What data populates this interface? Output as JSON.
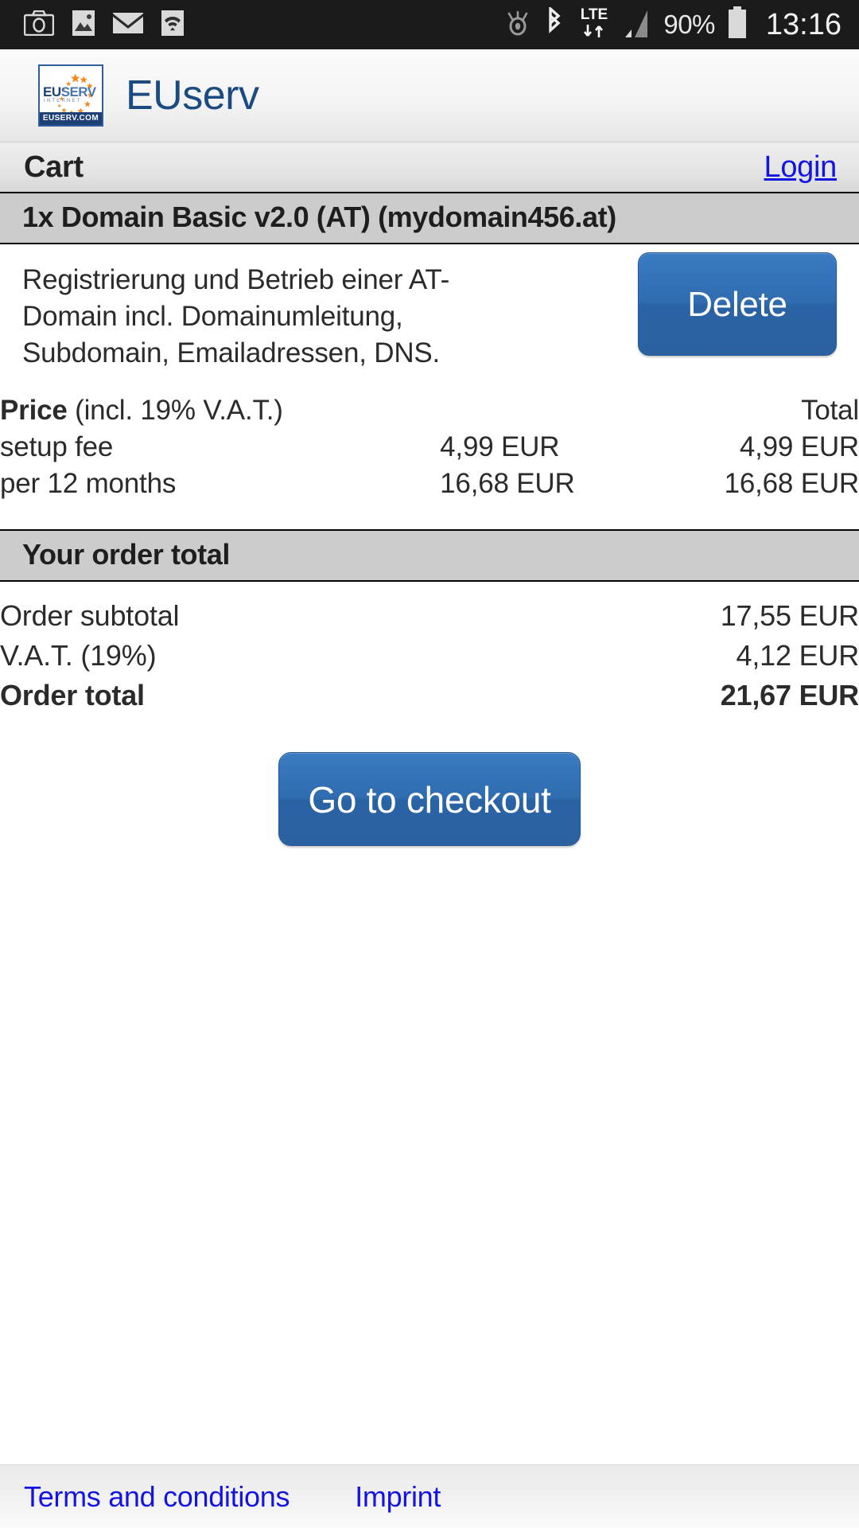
{
  "statusbar": {
    "left_icons": [
      "camera-icon",
      "image-icon",
      "email-icon",
      "wifi-icon"
    ],
    "right_icons": [
      "eye-icon",
      "bluetooth-icon",
      "lte-icon",
      "signal-icon",
      "battery-icon"
    ],
    "lte_label": "LTE",
    "battery_percent": "90%",
    "clock": "13:16",
    "background": "#1b1b1b"
  },
  "brand": {
    "logo_alt": "euserv-logo",
    "logo_text_eu": "EU",
    "logo_text_serv": "SERV",
    "logo_sub": "INTERNET",
    "logo_footer": "EUSERV.COM",
    "title": "EUserv",
    "title_color": "#1c4b82"
  },
  "cartbar": {
    "title": "Cart",
    "login_label": "Login",
    "link_color": "#1414e0"
  },
  "item": {
    "header": "1x Domain Basic v2.0 (AT) (mydomain456.at)",
    "description": "Registrierung und Betrieb einer AT-Domain incl. Domainumleitung, Subdomain, Emailadressen, DNS.",
    "delete_label": "Delete",
    "price_header_bold": "Price",
    "price_header_note": "(incl. 19% V.A.T.)",
    "total_header": "Total",
    "rows": [
      {
        "label": "setup fee",
        "price": "4,99 EUR",
        "total": "4,99 EUR"
      },
      {
        "label": "per 12 months",
        "price": "16,68 EUR",
        "total": "16,68 EUR"
      }
    ]
  },
  "order": {
    "header": "Your order total",
    "subtotal_label": "Order subtotal",
    "subtotal_value": "17,55 EUR",
    "vat_label": "V.A.T. (19%)",
    "vat_value": "4,12 EUR",
    "total_label": "Order total",
    "total_value": "21,67 EUR",
    "checkout_label": "Go to checkout",
    "button_color": "#2f6cb0"
  },
  "footer": {
    "terms_label": "Terms and conditions",
    "imprint_label": "Imprint"
  }
}
